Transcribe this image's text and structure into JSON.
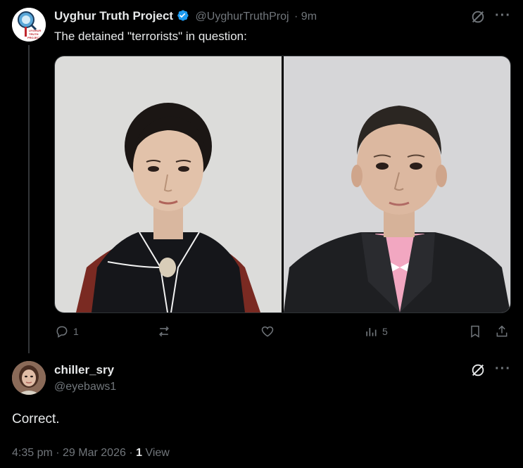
{
  "post": {
    "author_name": "Uyghur Truth Project",
    "author_handle": "@UyghurTruthProj",
    "time": "· 9m",
    "text": "The detained \"terrorists\" in question:",
    "avatar_text": "UYGHUR TRUTH PROJECT",
    "stats": {
      "replies": "1",
      "views": "5"
    }
  },
  "reply": {
    "author_name": "chiller_sry",
    "author_handle": "@eyebaws1",
    "text": "Correct.",
    "timestamp": "4:35 pm · 29 Mar 2026 ·",
    "view_count": "1",
    "view_label": "View"
  },
  "colors": {
    "background": "#000000",
    "text": "#e7e9ea",
    "muted": "#71767b",
    "verified": "#1d9bf0"
  }
}
